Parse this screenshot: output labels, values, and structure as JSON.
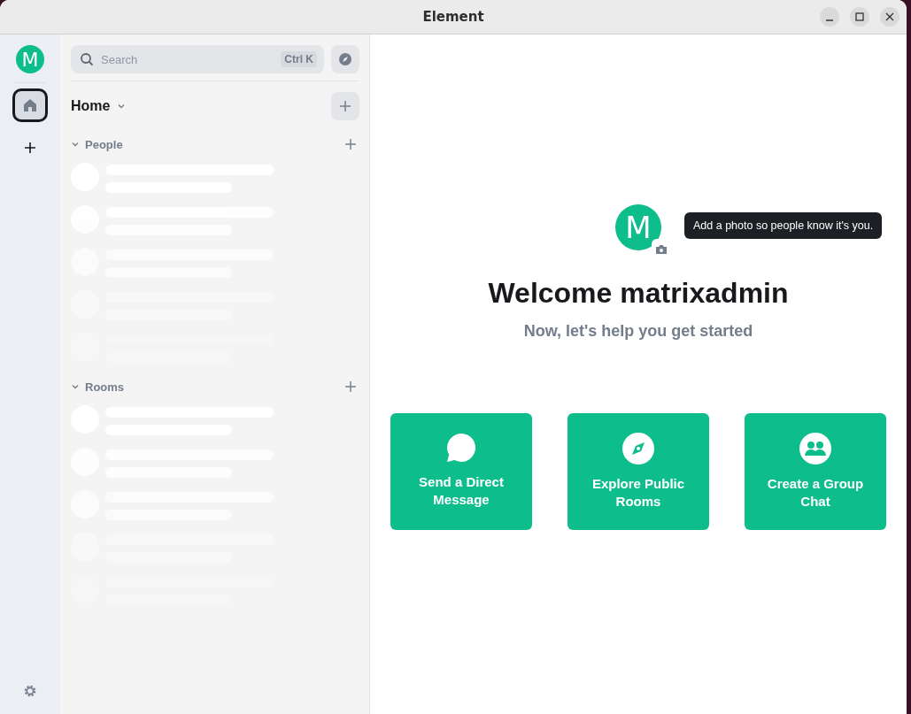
{
  "window": {
    "title": "Element"
  },
  "space_bar": {
    "avatar_initial": "M"
  },
  "room_list": {
    "search": {
      "placeholder": "Search",
      "shortcut": "Ctrl K"
    },
    "header": {
      "title": "Home"
    },
    "sections": [
      {
        "title": "People",
        "expanded": true
      },
      {
        "title": "Rooms",
        "expanded": true
      }
    ]
  },
  "main": {
    "avatar_initial": "M",
    "tooltip": "Add a photo so people know it's you.",
    "title": "Welcome matrixadmin",
    "subtitle": "Now, let's help you get started",
    "actions": [
      {
        "kind": "message",
        "label": "Send a Direct Message"
      },
      {
        "kind": "explore",
        "label": "Explore Public Rooms"
      },
      {
        "kind": "group",
        "label": "Create a Group Chat"
      }
    ]
  }
}
